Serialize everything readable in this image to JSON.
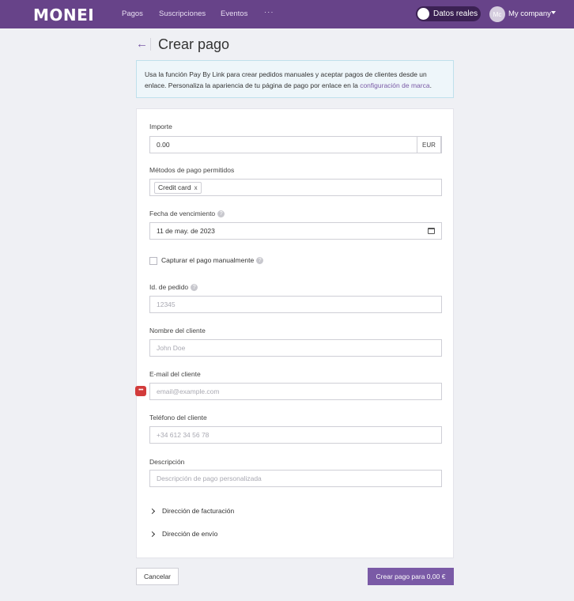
{
  "header": {
    "logo": "MONEI",
    "nav": [
      "Pagos",
      "Suscripciones",
      "Eventos",
      "···"
    ],
    "toggle_label": "Datos reales",
    "avatar_initials": "Mc",
    "company": "My company",
    "brand_color": "#674389"
  },
  "page": {
    "title": "Crear pago"
  },
  "info": {
    "text": "Usa la función Pay By Link para crear pedidos manuales y aceptar pagos de clientes desde un enlace. Personaliza la apariencia de tu página de pago por enlace en la ",
    "link": "configuración de marca",
    "suffix": "."
  },
  "form": {
    "amount_label": "Importe",
    "amount_value": "0.00",
    "currency": "EUR",
    "methods_label": "Métodos de pago permitidos",
    "method_tag": "Credit card",
    "method_tag_remove": "x",
    "due_label": "Fecha de vencimiento",
    "due_value": "11 de may. de 2023",
    "capture_label": "Capturar el pago manualmente",
    "order_label": "Id. de pedido",
    "order_placeholder": "12345",
    "name_label": "Nombre del cliente",
    "name_placeholder": "John Doe",
    "email_label": "E-mail del cliente",
    "email_placeholder": "email@example.com",
    "phone_label": "Teléfono del cliente",
    "phone_placeholder": "+34 612 34 56 78",
    "desc_label": "Descripción",
    "desc_placeholder": "Descripción de pago personalizada",
    "billing_label": "Dirección de facturación",
    "shipping_label": "Dirección de envío"
  },
  "footer": {
    "cancel": "Cancelar",
    "create": "Crear pago para 0,00 €",
    "accent": "#7a5aa6"
  }
}
